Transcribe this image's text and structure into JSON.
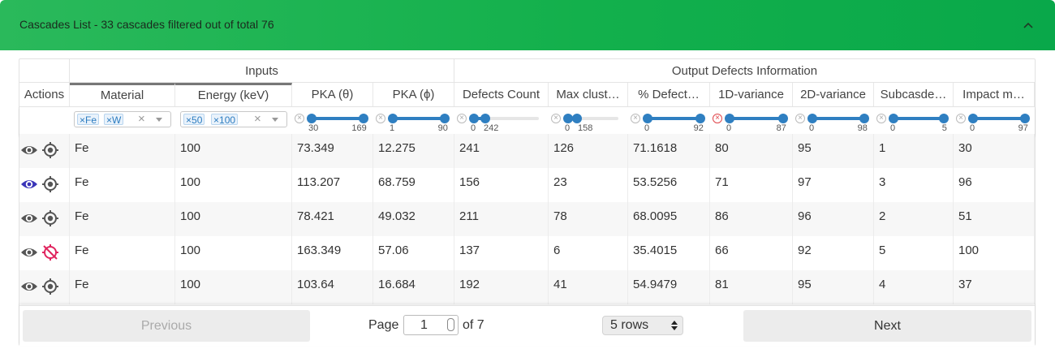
{
  "panel": {
    "title": "Cascades List - 33 cascades filtered out of total 76",
    "accent": "#13b04c"
  },
  "groups": {
    "inputs": "Inputs",
    "outputs": "Output Defects Information"
  },
  "columns": [
    "Actions",
    "Material",
    "Energy (keV)",
    "PKA (θ)",
    "PKA (ϕ)",
    "Defects Count",
    "Max clust…",
    "% Defect…",
    "1D-variance",
    "2D-variance",
    "Subcasde…",
    "Impact m…"
  ],
  "filters": {
    "material": {
      "chips": [
        "Fe",
        "W"
      ],
      "clear": "×"
    },
    "energy": {
      "chips": [
        "50",
        "100"
      ],
      "clear": "×"
    },
    "ranges": [
      {
        "min": "30",
        "max": "169",
        "lo": 0.0,
        "hi": 1.0,
        "cleared": false
      },
      {
        "min": "1",
        "max": "90",
        "lo": 0.0,
        "hi": 1.0,
        "cleared": false
      },
      {
        "min": "0",
        "max": "242",
        "lo": 0.0,
        "hi": 0.17,
        "cleared": false
      },
      {
        "min": "0",
        "max": "158",
        "lo": 0.0,
        "hi": 0.17,
        "cleared": false
      },
      {
        "min": "0",
        "max": "92",
        "lo": 0.0,
        "hi": 1.0,
        "cleared": false
      },
      {
        "min": "0",
        "max": "87",
        "lo": 0.0,
        "hi": 1.0,
        "cleared": true
      },
      {
        "min": "0",
        "max": "98",
        "lo": 0.0,
        "hi": 1.0,
        "cleared": false
      },
      {
        "min": "0",
        "max": "5",
        "lo": 0.0,
        "hi": 1.0,
        "cleared": false
      },
      {
        "min": "0",
        "max": "97",
        "lo": 0.0,
        "hi": 1.0,
        "cleared": false
      }
    ]
  },
  "rows": [
    {
      "view_active": false,
      "target_disabled": false,
      "cells": [
        "Fe",
        "100",
        "73.349",
        "12.275",
        "241",
        "126",
        "71.1618",
        "80",
        "95",
        "1",
        "30"
      ]
    },
    {
      "view_active": true,
      "target_disabled": false,
      "cells": [
        "Fe",
        "100",
        "113.207",
        "68.759",
        "156",
        "23",
        "53.5256",
        "71",
        "97",
        "3",
        "96"
      ]
    },
    {
      "view_active": false,
      "target_disabled": false,
      "cells": [
        "Fe",
        "100",
        "78.421",
        "49.032",
        "211",
        "78",
        "68.0095",
        "86",
        "96",
        "2",
        "51"
      ]
    },
    {
      "view_active": false,
      "target_disabled": true,
      "cells": [
        "Fe",
        "100",
        "163.349",
        "57.06",
        "137",
        "6",
        "35.4015",
        "66",
        "92",
        "5",
        "100"
      ]
    },
    {
      "view_active": false,
      "target_disabled": false,
      "cells": [
        "Fe",
        "100",
        "103.64",
        "16.684",
        "192",
        "41",
        "54.9479",
        "81",
        "95",
        "4",
        "37"
      ]
    }
  ],
  "pager": {
    "previous": "Previous",
    "page_label": "Page",
    "page_value": "1",
    "of_label": "of 7",
    "rows_select": "5 rows",
    "next": "Next"
  },
  "colors": {
    "slider": "#2f7fc1",
    "view_active": "#3a35b8",
    "target_disabled": "#e0245e",
    "icon": "#555555"
  }
}
